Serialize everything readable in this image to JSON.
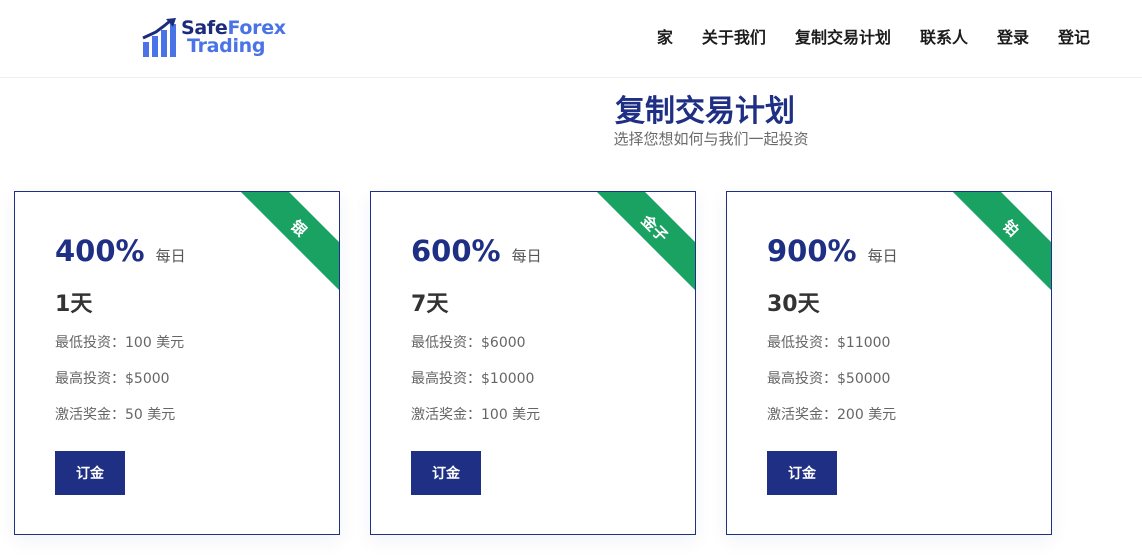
{
  "header": {
    "logo": {
      "brand_line1_a": "Safe",
      "brand_line1_b": "Forex",
      "brand_line2": "Trading"
    },
    "nav": [
      {
        "label": "家"
      },
      {
        "label": "关于我们"
      },
      {
        "label": "复制交易计划"
      },
      {
        "label": "联系人"
      },
      {
        "label": "登录"
      },
      {
        "label": "登记"
      }
    ]
  },
  "hero": {
    "title": "复制交易计划",
    "subtitle": "选择您想如何与我们一起投资"
  },
  "plans": [
    {
      "ribbon": "银",
      "percent": "400%",
      "percent_unit": "每日",
      "days_num": "1",
      "days_unit": "天",
      "min_invest": "最低投资：100 美元",
      "max_invest": "最高投资：$5000",
      "bonus": "激活奖金：50 美元",
      "button": "订金"
    },
    {
      "ribbon": "金子",
      "percent": "600%",
      "percent_unit": "每日",
      "days_num": "7",
      "days_unit": "天",
      "min_invest": "最低投资：$6000",
      "max_invest": "最高投资：$10000",
      "bonus": "激活奖金：100 美元",
      "button": "订金"
    },
    {
      "ribbon": "铂",
      "percent": "900%",
      "percent_unit": "每日",
      "days_num": "30",
      "days_unit": "天",
      "min_invest": "最低投资：$11000",
      "max_invest": "最高投资：$50000",
      "bonus": "激活奖金：200 美元",
      "button": "订金"
    }
  ],
  "colors": {
    "primary": "#1e2f84",
    "accent": "#4a73e8",
    "ribbon": "#1aa262"
  }
}
